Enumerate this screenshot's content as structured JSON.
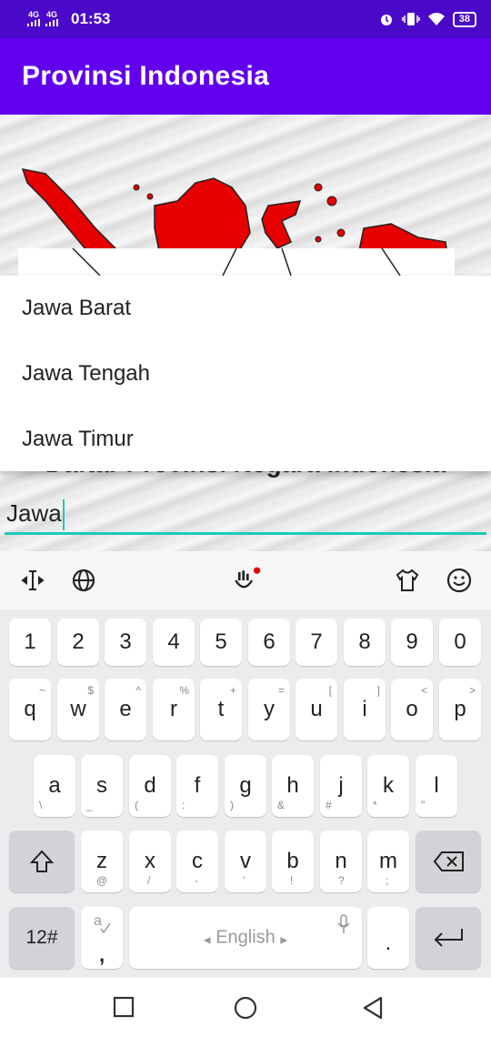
{
  "status_bar": {
    "net1": "4G",
    "net2": "4G",
    "time": "01:53",
    "battery": "38"
  },
  "app_title": "Provinsi Indonesia",
  "headline": "Daftar Provinsi Negara Indonesia",
  "input": {
    "value": "Jawa"
  },
  "dropdown": [
    "Jawa Barat",
    "Jawa Tengah",
    "Jawa Timur"
  ],
  "keyboard": {
    "numbers": [
      "1",
      "2",
      "3",
      "4",
      "5",
      "6",
      "7",
      "8",
      "9",
      "0"
    ],
    "row1": [
      {
        "k": "q",
        "s": "~"
      },
      {
        "k": "w",
        "s": "$"
      },
      {
        "k": "e",
        "s": "^"
      },
      {
        "k": "r",
        "s": "%"
      },
      {
        "k": "t",
        "s": "+"
      },
      {
        "k": "y",
        "s": "="
      },
      {
        "k": "u",
        "s": "["
      },
      {
        "k": "i",
        "s": "]"
      },
      {
        "k": "o",
        "s": "<"
      },
      {
        "k": "p",
        "s": ">"
      }
    ],
    "row2": [
      {
        "k": "a",
        "s": "\\"
      },
      {
        "k": "s",
        "s": "_"
      },
      {
        "k": "d",
        "s": "("
      },
      {
        "k": "f",
        "s": ":"
      },
      {
        "k": "g",
        "s": ")"
      },
      {
        "k": "h",
        "s": "&"
      },
      {
        "k": "j",
        "s": "#"
      },
      {
        "k": "k",
        "s": "*"
      },
      {
        "k": "l",
        "s": "\""
      }
    ],
    "row3": [
      {
        "k": "z",
        "s": "@"
      },
      {
        "k": "x",
        "s": "/"
      },
      {
        "k": "c",
        "s": "-"
      },
      {
        "k": "v",
        "s": "'"
      },
      {
        "k": "b",
        "s": "!"
      },
      {
        "k": "n",
        "s": "?"
      },
      {
        "k": "m",
        "s": ";"
      }
    ],
    "symbols_label": "12#",
    "comma_key": ",",
    "space_label": "English",
    "period_key": "."
  },
  "colors": {
    "status_bar": "#4a08c9",
    "app_bar": "#6200ee",
    "accent": "#1ec9b7"
  }
}
